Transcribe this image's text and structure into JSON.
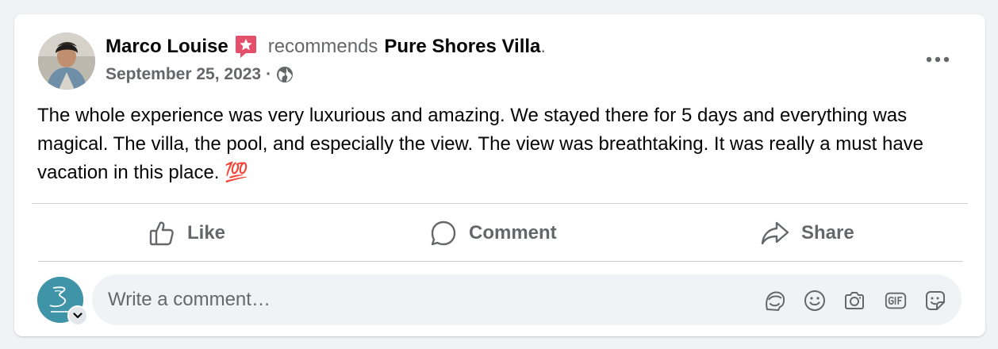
{
  "post": {
    "author": "Marco Louise",
    "action": "recommends",
    "page": "Pure Shores Villa",
    "period": ".",
    "date": "September 25, 2023",
    "separator": "·",
    "privacy_icon": "globe-icon",
    "body": "The whole experience was very luxurious and amazing. We stayed there for 5 days and everything was magical. The villa, the pool, and especially the view. The view was breathtaking. It was really a must have vacation in this place.",
    "emoji": "💯"
  },
  "actions": {
    "like": "Like",
    "comment": "Comment",
    "share": "Share"
  },
  "composer": {
    "placeholder": "Write a comment…",
    "icons": [
      "avatar-sticker-icon",
      "emoji-icon",
      "camera-icon",
      "gif-icon",
      "sticker-icon"
    ]
  },
  "colors": {
    "badge": "#e4506b",
    "secondary_text": "#65676b",
    "divider": "#ced0d4",
    "page_avatar": "#3f94a8"
  }
}
